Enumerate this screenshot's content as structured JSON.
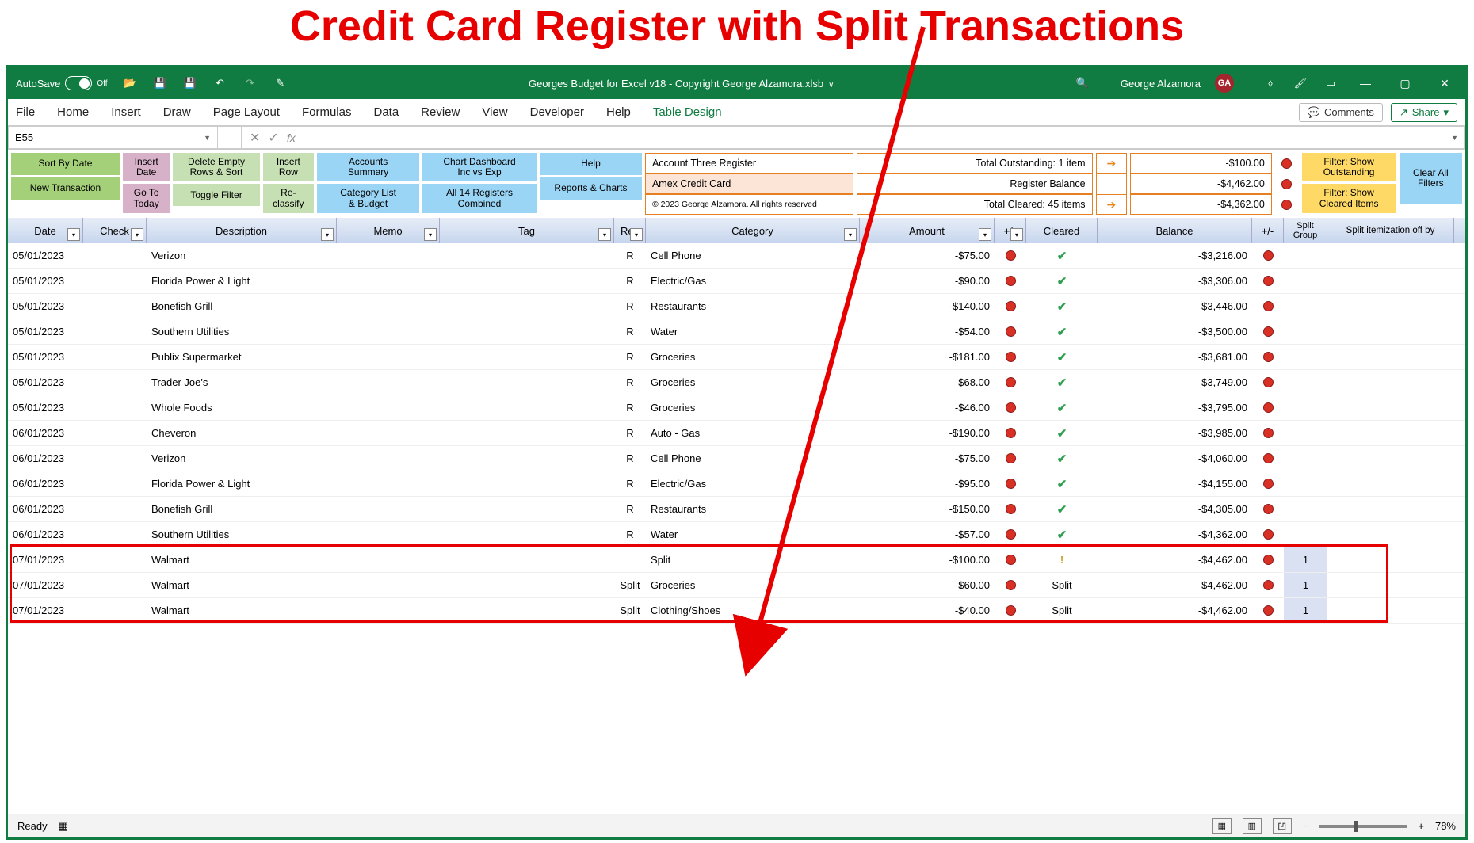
{
  "overlay_title": "Credit Card Register with Split Transactions",
  "titlebar": {
    "autosave": "AutoSave",
    "autosave_state": "Off",
    "filename": "Georges Budget for Excel v18 - Copyright George Alzamora.xlsb",
    "username": "George Alzamora",
    "user_initials": "GA"
  },
  "ribbon": {
    "tabs": [
      "File",
      "Home",
      "Insert",
      "Draw",
      "Page Layout",
      "Formulas",
      "Data",
      "Review",
      "View",
      "Developer",
      "Help",
      "Table Design"
    ],
    "active_tab": "Table Design",
    "comments_btn": "Comments",
    "share_btn": "Share"
  },
  "formula_bar": {
    "cell_ref": "E55",
    "fx": "fx",
    "formula": ""
  },
  "toolbar": {
    "row1": {
      "sort_by_date": "Sort By Date",
      "insert_date": "Insert\nDate",
      "delete_empty": "Delete Empty\nRows & Sort",
      "insert_row": "Insert\nRow",
      "accounts_summary": "Accounts\nSummary",
      "chart_dashboard": "Chart Dashboard\nInc vs Exp",
      "help": "Help"
    },
    "row2": {
      "new_transaction": "New Transaction",
      "goto_today": "Go To\nToday",
      "toggle_filter": "Toggle Filter",
      "reclassify": "Re-\nclassify",
      "category_list": "Category List\n& Budget",
      "all_registers": "All 14 Registers\nCombined",
      "reports_charts": "Reports & Charts"
    },
    "filter_outstanding": "Filter: Show\nOutstanding",
    "filter_cleared": "Filter: Show\nCleared Items",
    "clear_filters": "Clear All\nFilters"
  },
  "info": {
    "account_register": "Account Three Register",
    "account_name": "Amex Credit Card",
    "copyright": "© 2023 George Alzamora. All rights reserved",
    "total_outstanding_label": "Total Outstanding: 1 item",
    "total_outstanding_value": "-$100.00",
    "register_balance_label": "Register Balance",
    "register_balance_value": "-$4,462.00",
    "total_cleared_label": "Total Cleared: 45 items",
    "total_cleared_value": "-$4,362.00"
  },
  "columns": [
    "Date",
    "Check",
    "Description",
    "Memo",
    "Tag",
    "Rec",
    "Category",
    "Amount",
    "+/-",
    "Cleared",
    "Balance",
    "+/-",
    "Split Group",
    "Split itemization off by"
  ],
  "transactions": [
    {
      "date": "05/01/2023",
      "desc": "Verizon",
      "rec": "R",
      "cat": "Cell Phone",
      "amount": "-$75.00",
      "cleared": "check",
      "balance": "-$3,216.00",
      "sg": "",
      "recText": "R"
    },
    {
      "date": "05/01/2023",
      "desc": "Florida Power & Light",
      "rec": "R",
      "cat": "Electric/Gas",
      "amount": "-$90.00",
      "cleared": "check",
      "balance": "-$3,306.00",
      "sg": ""
    },
    {
      "date": "05/01/2023",
      "desc": "Bonefish Grill",
      "rec": "R",
      "cat": "Restaurants",
      "amount": "-$140.00",
      "cleared": "check",
      "balance": "-$3,446.00",
      "sg": ""
    },
    {
      "date": "05/01/2023",
      "desc": "Southern Utilities",
      "rec": "R",
      "cat": "Water",
      "amount": "-$54.00",
      "cleared": "check",
      "balance": "-$3,500.00",
      "sg": ""
    },
    {
      "date": "05/01/2023",
      "desc": "Publix Supermarket",
      "rec": "R",
      "cat": "Groceries",
      "amount": "-$181.00",
      "cleared": "check",
      "balance": "-$3,681.00",
      "sg": ""
    },
    {
      "date": "05/01/2023",
      "desc": "Trader Joe's",
      "rec": "R",
      "cat": "Groceries",
      "amount": "-$68.00",
      "cleared": "check",
      "balance": "-$3,749.00",
      "sg": ""
    },
    {
      "date": "05/01/2023",
      "desc": "Whole Foods",
      "rec": "R",
      "cat": "Groceries",
      "amount": "-$46.00",
      "cleared": "check",
      "balance": "-$3,795.00",
      "sg": ""
    },
    {
      "date": "06/01/2023",
      "desc": "Cheveron",
      "rec": "R",
      "cat": "Auto - Gas",
      "amount": "-$190.00",
      "cleared": "check",
      "balance": "-$3,985.00",
      "sg": ""
    },
    {
      "date": "06/01/2023",
      "desc": "Verizon",
      "rec": "R",
      "cat": "Cell Phone",
      "amount": "-$75.00",
      "cleared": "check",
      "balance": "-$4,060.00",
      "sg": ""
    },
    {
      "date": "06/01/2023",
      "desc": "Florida Power & Light",
      "rec": "R",
      "cat": "Electric/Gas",
      "amount": "-$95.00",
      "cleared": "check",
      "balance": "-$4,155.00",
      "sg": ""
    },
    {
      "date": "06/01/2023",
      "desc": "Bonefish Grill",
      "rec": "R",
      "cat": "Restaurants",
      "amount": "-$150.00",
      "cleared": "check",
      "balance": "-$4,305.00",
      "sg": ""
    },
    {
      "date": "06/01/2023",
      "desc": "Southern Utilities",
      "rec": "R",
      "cat": "Water",
      "amount": "-$57.00",
      "cleared": "check",
      "balance": "-$4,362.00",
      "sg": ""
    },
    {
      "date": "07/01/2023",
      "desc": "Walmart",
      "rec": "",
      "cat": "Split",
      "amount": "-$100.00",
      "cleared": "exclaim",
      "balance": "-$4,462.00",
      "sg": "1",
      "split": true
    },
    {
      "date": "07/01/2023",
      "desc": "Walmart",
      "rec": "Split",
      "cat": "Groceries",
      "amount": "-$60.00",
      "cleared": "Split",
      "balance": "-$4,462.00",
      "sg": "1",
      "split": true
    },
    {
      "date": "07/01/2023",
      "desc": "Walmart",
      "rec": "Split",
      "cat": "Clothing/Shoes",
      "amount": "-$40.00",
      "cleared": "Split",
      "balance": "-$4,462.00",
      "sg": "1",
      "split": true
    }
  ],
  "statusbar": {
    "ready": "Ready",
    "zoom": "78%"
  }
}
